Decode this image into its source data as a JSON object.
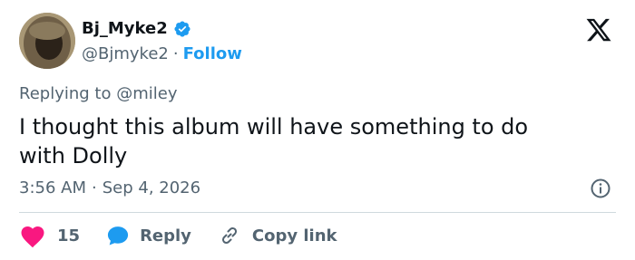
{
  "user": {
    "display_name": "Bj_Myke2",
    "handle": "@Bjmyke2",
    "separator": "·",
    "follow_label": "Follow"
  },
  "tweet": {
    "replying_prefix": "Replying to",
    "replying_handle": "@miley",
    "text": "I thought this album will have something to do\nwith Dolly",
    "time": "3:56 AM",
    "separator": "·",
    "date": "Sep 4, 2026"
  },
  "actions": {
    "like_count": "15",
    "reply_label": "Reply",
    "copy_label": "Copy link"
  },
  "icons": {
    "logo": "x-logo-icon",
    "verified": "verified-badge-icon",
    "info": "info-icon",
    "like": "heart-icon",
    "reply": "speech-bubble-icon",
    "copy": "link-icon"
  },
  "colors": {
    "text": "#0f1419",
    "secondary": "#536471",
    "accent": "#1d9bf0",
    "like": "#f91880",
    "divider": "#cfd9de"
  }
}
